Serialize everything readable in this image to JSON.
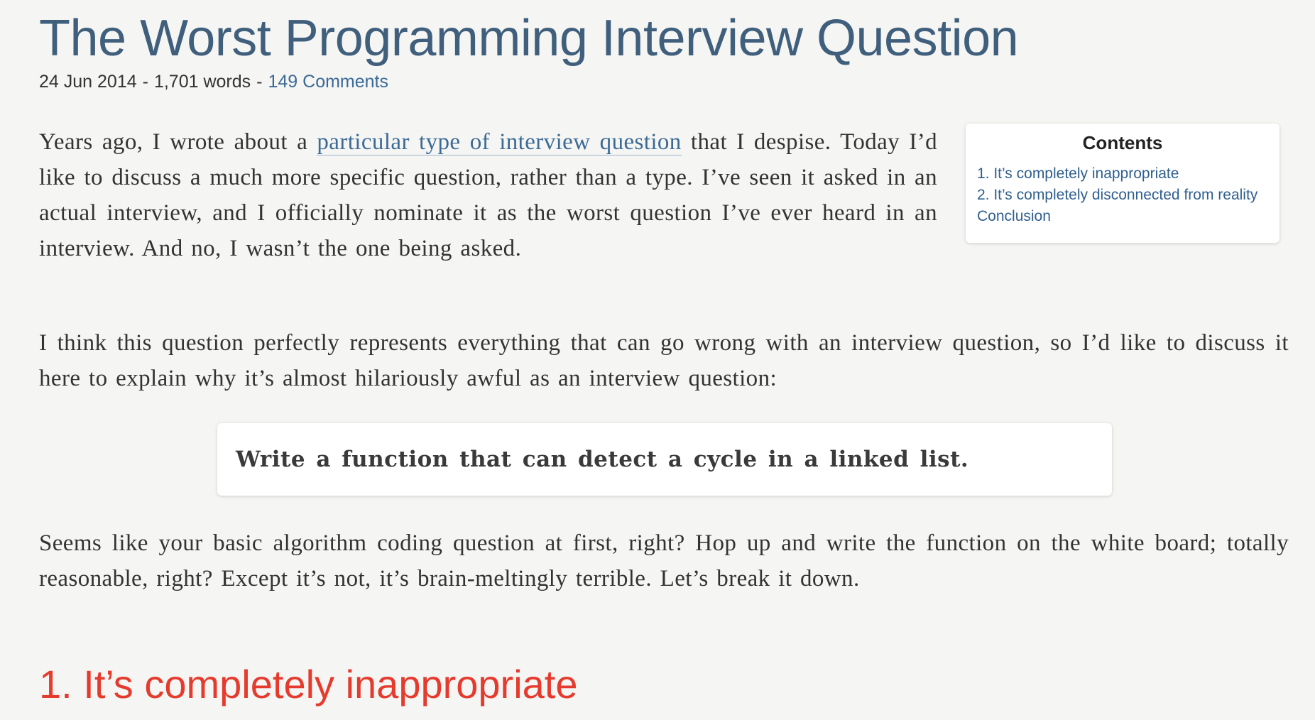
{
  "article": {
    "title": "The Worst Programming Interview Question",
    "date": "24 Jun 2014",
    "word_count": "1,701 words",
    "separator": "-",
    "comments": "149 Comments"
  },
  "contents": {
    "title": "Contents",
    "items": [
      "1. It’s completely inappropriate",
      "2. It’s completely disconnected from reality",
      "Conclusion"
    ]
  },
  "paragraphs": {
    "p1_before_link": "Years ago, I wrote about a ",
    "p1_link": "particular type of interview question",
    "p1_after_link": " that I despise. Today I’d like to discuss a much more specific question, rather than a type. I’ve seen it asked in an actual interview, and I officially nominate it as the worst question I’ve ever heard in an interview. And no, I wasn’t the one being asked.",
    "p2": "I think this question perfectly represents everything that can go wrong with an interview question, so I’d like to discuss it here to explain why it’s almost hilariously awful as an interview question:",
    "callout": "Write a function that can detect a cycle in a linked list.",
    "p3": "Seems like your basic algorithm coding question at first, right? Hop up and write the function on the white board; totally reasonable, right? Except it’s not, it’s brain-meltingly terrible. Let’s break it down."
  },
  "section": {
    "heading": "1. It’s completely inappropriate"
  },
  "colors": {
    "title": "#3f5f7c",
    "link": "#3b6a95",
    "section_heading": "#e53b2e",
    "background": "#f5f5f3"
  }
}
